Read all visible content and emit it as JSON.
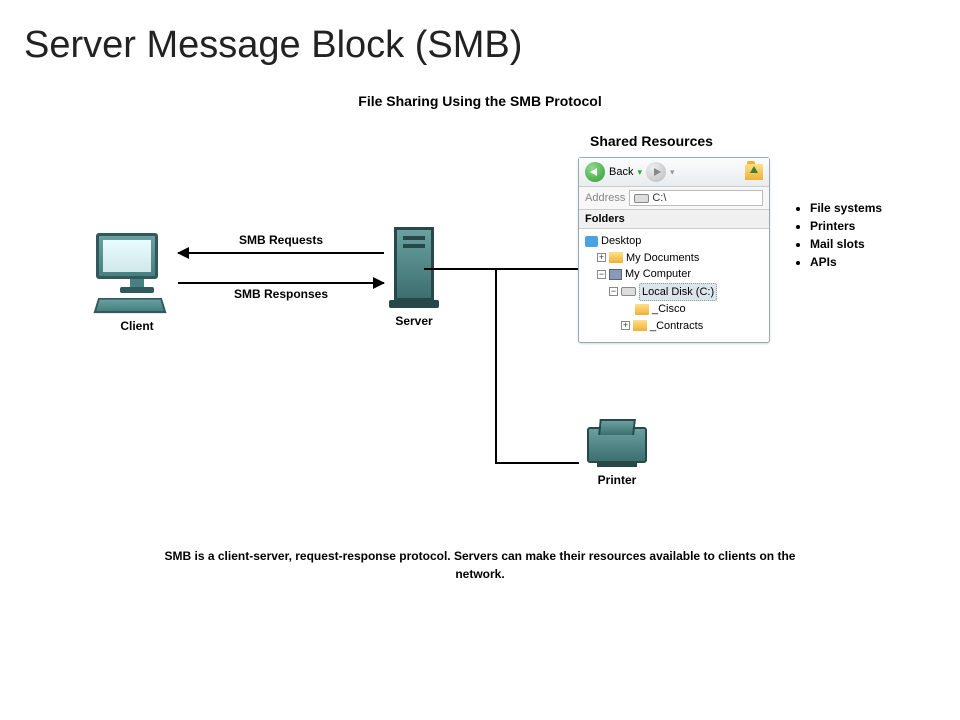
{
  "title": "Server Message Block (SMB)",
  "subtitle": "File Sharing Using the SMB Protocol",
  "client_label": "Client",
  "server_label": "Server",
  "printer_label": "Printer",
  "requests_label": "SMB Requests",
  "responses_label": "SMB Responses",
  "shared_resources_title": "Shared Resources",
  "explorer": {
    "back_label": "Back",
    "address_label": "Address",
    "address_value": "C:\\",
    "folders_label": "Folders",
    "tree": {
      "desktop": "Desktop",
      "my_documents": "My Documents",
      "my_computer": "My Computer",
      "local_disk": "Local Disk (C:)",
      "cisco": "_Cisco",
      "contracts": "_Contracts"
    }
  },
  "bullets": [
    "File systems",
    "Printers",
    "Mail slots",
    "APIs"
  ],
  "caption": "SMB is a client-server, request-response protocol. Servers can make their resources available to clients on the network."
}
